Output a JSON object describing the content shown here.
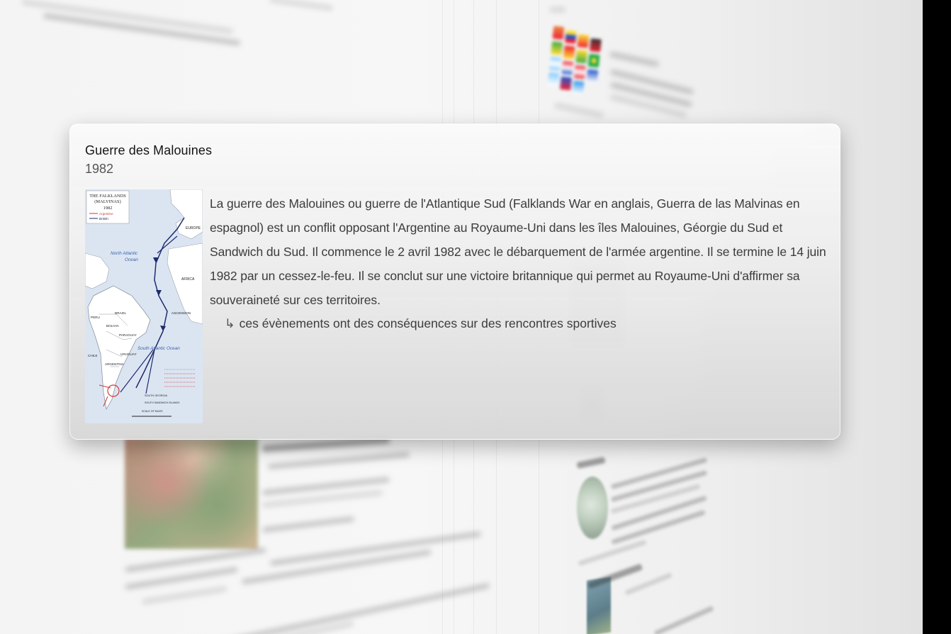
{
  "popup": {
    "title": "Guerre des Malouines",
    "year": "1982",
    "description": "La guerre des Malouines ou guerre de l'Atlantique Sud (Falklands War en anglais, Guerra de las Malvinas en espagnol) est un conflit opposant l'Argentine au Royaume-Uni dans les îles Malouines, Géorgie du Sud et Sandwich du Sud. Il commence le 2 avril 1982 avec le débarquement de l'armée argentine. Il se termine le 14 juin 1982 par un cessez-le-feu. Il se conclut sur une victoire britannique qui permet au Royaume-Uni d'affirmer sa souveraineté sur ces territoires.",
    "related_arrow": "↳",
    "related_text": "ces évènements ont des conséquences sur des rencontres sportives",
    "thumbnail": {
      "heading_line1": "THE FALKLANDS",
      "heading_line2": "(MALVINAS)",
      "heading_year": "1982",
      "legend_argentine": "Argentine",
      "legend_british": "British",
      "label_europe": "EUROPE",
      "label_africa": "AFRICA",
      "label_north_atlantic": "North Atlantic",
      "label_ocean": "Ocean",
      "label_south_atlantic": "South Atlantic Ocean",
      "label_brazil": "BRAZIL",
      "label_peru": "PERU",
      "label_bolivia": "BOLIVIA",
      "label_paraguay": "PARAGUAY",
      "label_chile": "CHILE",
      "label_uruguay": "URUGUAY",
      "label_argentina": "ARGENTINA",
      "label_ascension": "ASCENSION",
      "label_south_georgia": "SOUTH GEORGIA",
      "label_south_sandwich": "SOUTH SANDWICH ISLANDS",
      "label_scale": "SCALE OF MILES"
    }
  },
  "colors": {
    "map_sea": "#dbe5f2",
    "map_land": "#ffffff",
    "route_british": "#1e2a6e",
    "route_argentine": "#d23a3a"
  }
}
